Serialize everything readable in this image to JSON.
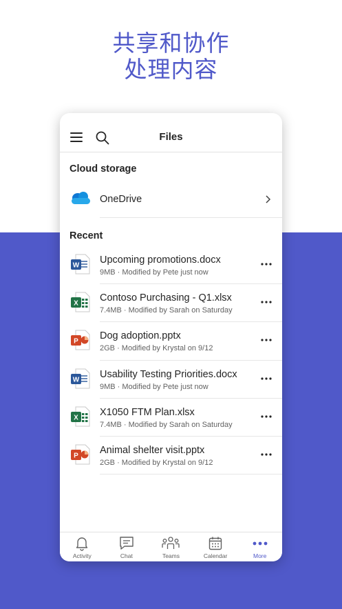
{
  "promo": {
    "line1": "共享和协作",
    "line2": "处理内容"
  },
  "header": {
    "title": "Files"
  },
  "cloud": {
    "section_title": "Cloud storage",
    "onedrive_label": "OneDrive"
  },
  "recent": {
    "section_title": "Recent",
    "files": [
      {
        "name": "Upcoming promotions.docx",
        "meta": "9MB · Modified by Pete just now",
        "type": "word"
      },
      {
        "name": "Contoso Purchasing - Q1.xlsx",
        "meta": "7.4MB · Modified by Sarah on Saturday",
        "type": "excel"
      },
      {
        "name": "Dog adoption.pptx",
        "meta": "2GB · Modified by Krystal on 9/12",
        "type": "powerpoint"
      },
      {
        "name": "Usability Testing Priorities.docx",
        "meta": "9MB · Modified by Pete just now",
        "type": "word"
      },
      {
        "name": "X1050 FTM Plan.xlsx",
        "meta": "7.4MB · Modified by Sarah on Saturday",
        "type": "excel"
      },
      {
        "name": "Animal shelter visit.pptx",
        "meta": "2GB · Modified by Krystal on 9/12",
        "type": "powerpoint"
      }
    ]
  },
  "tabs": [
    {
      "label": "Activity",
      "icon": "bell-icon"
    },
    {
      "label": "Chat",
      "icon": "chat-icon"
    },
    {
      "label": "Teams",
      "icon": "teams-icon"
    },
    {
      "label": "Calendar",
      "icon": "calendar-icon"
    },
    {
      "label": "More",
      "icon": "more-icon",
      "active": true
    }
  ],
  "colors": {
    "accent": "#5059C9",
    "word": "#2B579A",
    "excel": "#217346",
    "powerpoint": "#D24726",
    "onedrive": "#0F78D4"
  }
}
